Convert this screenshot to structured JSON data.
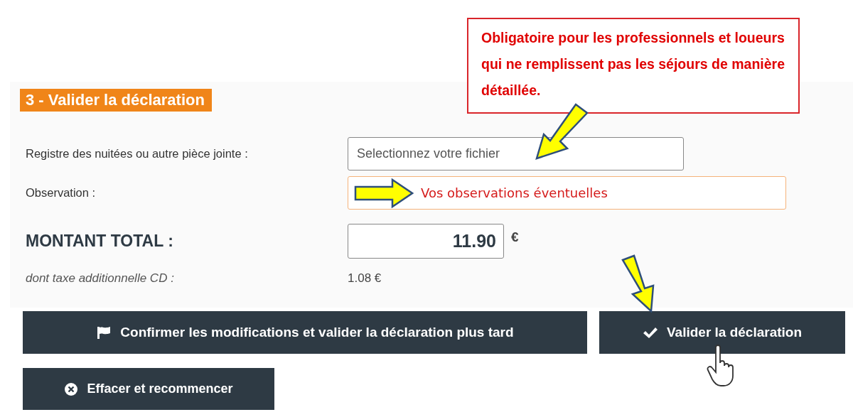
{
  "callout": {
    "text": "Obligatoire pour les professionnels et loueurs qui ne remplissent pas les séjours de manière détaillée."
  },
  "section": {
    "title": "3 - Valider la déclaration"
  },
  "fields": [
    {
      "kind": "file",
      "label": "Registre des nuitées ou autre pièce jointe :",
      "value": "Selectionnez votre fichier"
    },
    {
      "kind": "note",
      "label": "Observation :",
      "value": "Vos observations éventuelles"
    }
  ],
  "total": {
    "label": "MONTANT TOTAL :",
    "value": "11.90",
    "currency": "€"
  },
  "tax": {
    "label": "dont taxe additionnelle CD :",
    "value": "1.08 €"
  },
  "buttons": [
    {
      "kind": "flag",
      "label": "Confirmer les modifications et valider la déclaration plus tard"
    },
    {
      "kind": "check",
      "label": "Valider la déclaration"
    },
    {
      "kind": "clear",
      "label": "Effacer et recommencer"
    }
  ]
}
